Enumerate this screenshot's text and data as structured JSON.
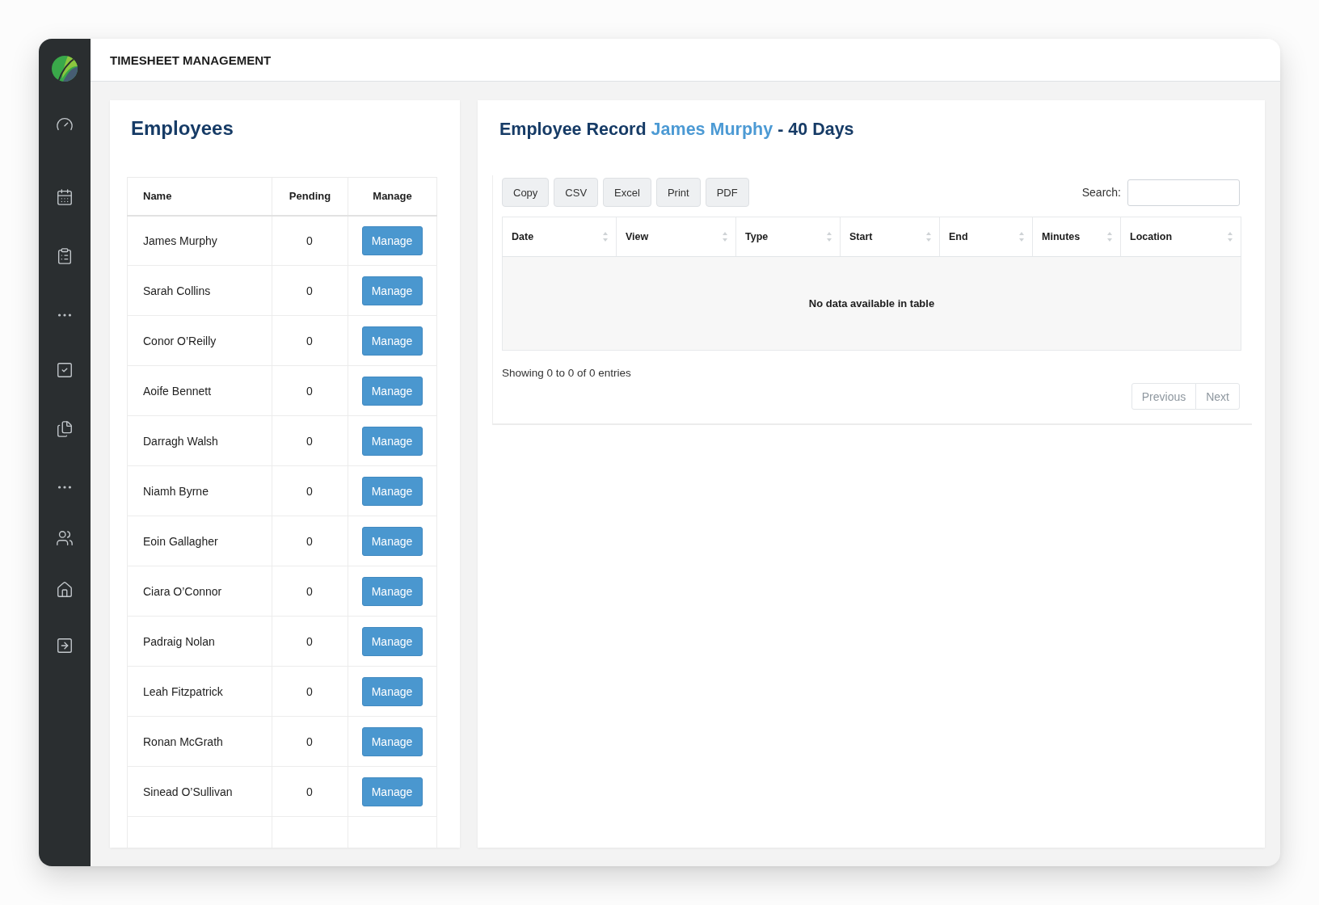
{
  "header": {
    "title": "TIMESHEET MANAGEMENT"
  },
  "employees_panel": {
    "title": "Employees",
    "table": {
      "columns": [
        "Name",
        "Pending",
        "Manage"
      ],
      "rows": [
        {
          "name": "James Murphy",
          "pending": "0",
          "action": "Manage"
        },
        {
          "name": "Sarah Collins",
          "pending": "0",
          "action": "Manage"
        },
        {
          "name": "Conor O’Reilly",
          "pending": "0",
          "action": "Manage"
        },
        {
          "name": "Aoife Bennett",
          "pending": "0",
          "action": "Manage"
        },
        {
          "name": "Darragh Walsh",
          "pending": "0",
          "action": "Manage"
        },
        {
          "name": "Niamh Byrne",
          "pending": "0",
          "action": "Manage"
        },
        {
          "name": "Eoin Gallagher",
          "pending": "0",
          "action": "Manage"
        },
        {
          "name": "Ciara O’Connor",
          "pending": "0",
          "action": "Manage"
        },
        {
          "name": "Padraig Nolan",
          "pending": "0",
          "action": "Manage"
        },
        {
          "name": "Leah Fitzpatrick",
          "pending": "0",
          "action": "Manage"
        },
        {
          "name": "Ronan McGrath",
          "pending": "0",
          "action": "Manage"
        },
        {
          "name": "Sinead O’Sullivan",
          "pending": "0",
          "action": "Manage"
        }
      ]
    }
  },
  "record_panel": {
    "title": {
      "prefix": "Employee Record",
      "name": "James Murphy",
      "suffix": "- 40 Days"
    },
    "export_buttons": [
      "Copy",
      "CSV",
      "Excel",
      "Print",
      "PDF"
    ],
    "search": {
      "label": "Search:"
    },
    "table": {
      "columns": [
        "Date",
        "View",
        "Type",
        "Start",
        "End",
        "Minutes",
        "Location"
      ],
      "empty_message": "No data available in table"
    },
    "info": "Showing 0 to 0 of 0 entries",
    "pagination": [
      {
        "label": "Previous",
        "disabled": true
      },
      {
        "label": "Next",
        "disabled": true
      }
    ]
  }
}
